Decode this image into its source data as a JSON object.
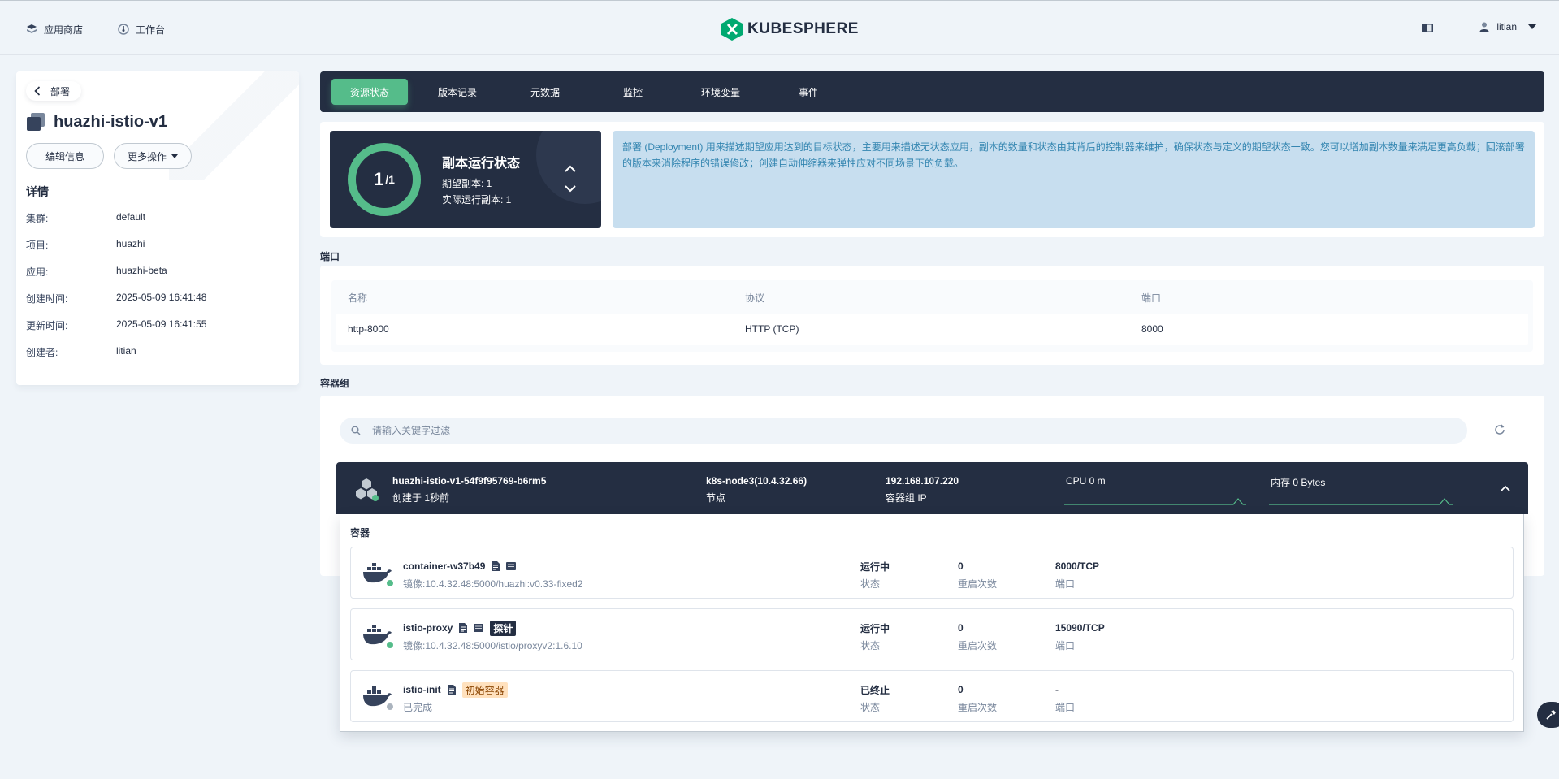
{
  "topbar": {
    "app_store": "应用商店",
    "workbench": "工作台",
    "brand": "KUBESPHERE",
    "user": "litian"
  },
  "resource": {
    "back_label": "部署",
    "name": "huazhi-istio-v1",
    "edit_label": "编辑信息",
    "more_label": "更多操作",
    "details_title": "详情",
    "details": [
      {
        "key": "集群:",
        "value": "default"
      },
      {
        "key": "项目:",
        "value": "huazhi"
      },
      {
        "key": "应用:",
        "value": "huazhi-beta"
      },
      {
        "key": "创建时间:",
        "value": "2025-05-09 16:41:48"
      },
      {
        "key": "更新时间:",
        "value": "2025-05-09 16:41:55"
      },
      {
        "key": "创建者:",
        "value": "litian"
      }
    ]
  },
  "tabs": [
    "资源状态",
    "版本记录",
    "元数据",
    "监控",
    "环境变量",
    "事件"
  ],
  "replica": {
    "current": "1",
    "total": "/1",
    "title": "副本运行状态",
    "desired": "期望副本: 1",
    "actual": "实际运行副本: 1"
  },
  "info_text": "部署 (Deployment) 用来描述期望应用达到的目标状态，主要用来描述无状态应用，副本的数量和状态由其背后的控制器来维护，确保状态与定义的期望状态一致。您可以增加副本数量来满足更高负载；回滚部署的版本来消除程序的错误修改；创建自动伸缩器来弹性应对不同场景下的负载。",
  "ports": {
    "section": "端口",
    "headers": [
      "名称",
      "协议",
      "端口"
    ],
    "rows": [
      [
        "http-8000",
        "HTTP (TCP)",
        "8000"
      ]
    ]
  },
  "pods": {
    "section": "容器组",
    "search_placeholder": "请输入关键字过滤",
    "pod": {
      "name": "huazhi-istio-v1-54f9f95769-b6rm5",
      "created": "创建于 1秒前",
      "node": "k8s-node3(10.4.32.66)",
      "node_label": "节点",
      "ip": "192.168.107.220",
      "ip_label": "容器组 IP",
      "cpu": "CPU 0 m",
      "memory": "内存 0 Bytes"
    },
    "containers_title": "容器",
    "containers": [
      {
        "name": "container-w37b49",
        "sub": "镜像:10.4.32.48:5000/huazhi:v0.33-fixed2",
        "status": "运行中",
        "status_label": "状态",
        "restarts": "0",
        "restarts_label": "重启次数",
        "port": "8000/TCP",
        "port_label": "端口",
        "tag": ""
      },
      {
        "name": "istio-proxy",
        "sub": "镜像:10.4.32.48:5000/istio/proxyv2:1.6.10",
        "status": "运行中",
        "status_label": "状态",
        "restarts": "0",
        "restarts_label": "重启次数",
        "port": "15090/TCP",
        "port_label": "端口",
        "tag": "探针"
      },
      {
        "name": "istio-init",
        "sub": "已完成",
        "status": "已终止",
        "status_label": "状态",
        "restarts": "0",
        "restarts_label": "重启次数",
        "port": "-",
        "port_label": "端口",
        "tag": "初始容器"
      }
    ]
  },
  "colors": {
    "accent": "#55bc8a",
    "dark": "#242e42",
    "info_bg": "#c7deef",
    "info_text": "#3385b0"
  }
}
